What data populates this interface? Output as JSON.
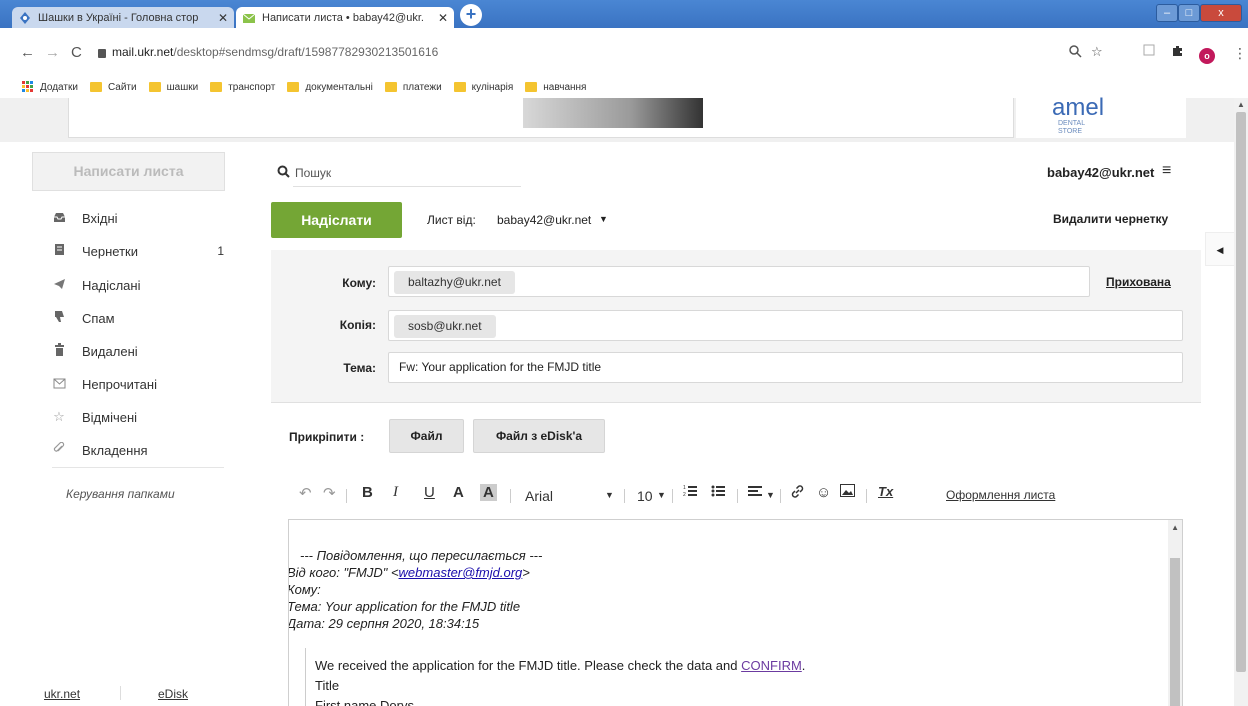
{
  "browser": {
    "tabs": [
      {
        "title": "Шашки в Україні - Головна стор",
        "close": "✕"
      },
      {
        "title": "Написати листа • babay42@ukr.",
        "close": "✕"
      }
    ],
    "new_tab": "+",
    "window_controls": {
      "minimize": "–",
      "maximize": "□",
      "close": "x"
    },
    "nav": {
      "back": "←",
      "forward": "→",
      "reload": "C"
    },
    "url_host": "mail.ukr.net",
    "url_path": "/desktop#sendmsg/draft/15987782930213501616",
    "profile_initial": "o",
    "bookmarks": [
      "Додатки",
      "Сайти",
      "шашки",
      "транспорт",
      "документальні",
      "платежи",
      "кулінарія",
      "навчання"
    ]
  },
  "ad": {
    "brand": "amel",
    "line1": "DENTAL",
    "line2": "STORE"
  },
  "sidebar": {
    "compose_label": "Написати листа",
    "folders": [
      {
        "label": "Вхідні",
        "icon": "inbox-icon",
        "count": ""
      },
      {
        "label": "Чернетки",
        "icon": "drafts-icon",
        "count": "1"
      },
      {
        "label": "Надіслані",
        "icon": "sent-icon",
        "count": ""
      },
      {
        "label": "Спам",
        "icon": "spam-icon",
        "count": ""
      },
      {
        "label": "Видалені",
        "icon": "trash-icon",
        "count": ""
      },
      {
        "label": "Непрочитані",
        "icon": "unread-icon",
        "count": ""
      },
      {
        "label": "Відмічені",
        "icon": "star-icon",
        "count": ""
      },
      {
        "label": "Вкладення",
        "icon": "attachment-icon",
        "count": ""
      }
    ],
    "manage_folders": "Керування папками",
    "footer_links": [
      "ukr.net",
      "eDisk"
    ]
  },
  "header": {
    "search_placeholder": "Пошук",
    "user_email": "babay42@ukr.net"
  },
  "compose": {
    "send_label": "Надіслати",
    "from_label": "Лист від:",
    "from_value": "babay42@ukr.net",
    "delete_draft": "Видалити чернетку",
    "to_label": "Кому:",
    "to_value": "baltazhy@ukr.net",
    "bcc_label": "Прихована",
    "cc_label": "Копія:",
    "cc_value": "sosb@ukr.net",
    "subject_label": "Тема:",
    "subject_value": "Fw: Your application for the FMJD title",
    "attach_label": "Прикріпити :",
    "attach_file": "Файл",
    "attach_edisk": "Файл з eDisk'а"
  },
  "toolbar": {
    "undo": "↶",
    "redo": "↷",
    "bold": "B",
    "italic": "I",
    "underline": "U",
    "text_color": "A",
    "bg_color": "A",
    "font_name": "Arial",
    "font_size": "10",
    "design_link": "Оформлення листа"
  },
  "editor": {
    "fwd_header": "--- Повідомлення, що пересилається ---",
    "from_prefix": "Від кого: \"FMJD\" <",
    "from_email": "webmaster@fmjd.org",
    "from_suffix": ">",
    "to_line": "Кому:",
    "subject_line": "Тема: Your application for the FMJD title",
    "date_line": "Дата: 29 серпня 2020, 18:34:15",
    "body_line1": "We received the application for the FMJD title. Please check the data and",
    "confirm_link": "CONFIRM",
    "body_line1_end": ".",
    "body_line2": "Title",
    "body_line3": "First name Dorys"
  }
}
